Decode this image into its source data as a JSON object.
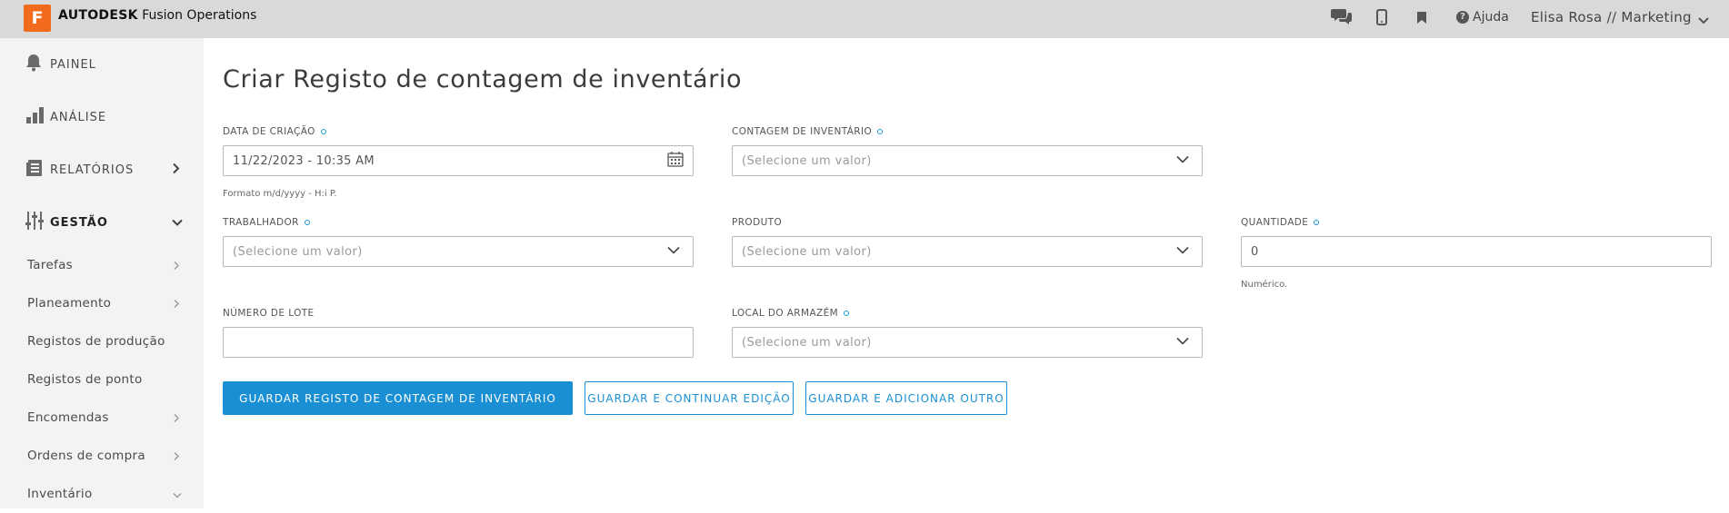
{
  "header": {
    "logo_letter": "F",
    "brand_bold": "AUTODESK",
    "brand_rest": "Fusion Operations",
    "help_label": "Ajuda",
    "user_label": "Elisa Rosa // Marketing",
    "icons": [
      "chat-icon",
      "mobile-icon",
      "bookmark-icon",
      "help-icon",
      "chevron-down-icon"
    ]
  },
  "sidebar": {
    "main_items": [
      {
        "label": "PAINEL",
        "icon": "bell-icon"
      },
      {
        "label": "ANÁLISE",
        "icon": "bar-chart-icon"
      },
      {
        "label": "RELATÓRIOS",
        "icon": "reports-icon"
      },
      {
        "label": "GESTÃO",
        "icon": "sliders-icon"
      }
    ],
    "sub_items": [
      {
        "label": "Tarefas"
      },
      {
        "label": "Planeamento"
      },
      {
        "label": "Registos de produção"
      },
      {
        "label": "Registos de ponto"
      },
      {
        "label": "Encomendas"
      },
      {
        "label": "Ordens de compra"
      },
      {
        "label": "Inventário"
      }
    ]
  },
  "form": {
    "title": "Criar Registo de contagem de inventário",
    "date_label": "DATA DE CRIAÇÃO",
    "date_value": "11/22/2023 - 10:35 AM",
    "date_hint": "Formato m/d/yyyy - H:i P.",
    "count_label": "CONTAGEM DE INVENTÁRIO",
    "count_placeholder": "(Selecione um valor)",
    "worker_label": "TRABALHADOR",
    "worker_placeholder": "(Selecione um valor)",
    "product_label": "PRODUTO",
    "product_placeholder": "(Selecione um valor)",
    "quantity_label": "QUANTIDADE",
    "quantity_value": "0",
    "quantity_hint": "Numérico.",
    "lot_label": "NÚMERO DE LOTE",
    "lot_value": "",
    "warehouse_label": "LOCAL DO ARMAZÉM",
    "warehouse_placeholder": "(Selecione um valor)"
  },
  "buttons": {
    "save_label": "GUARDAR REGISTO DE CONTAGEM DE INVENTÁRIO",
    "save_continue_label": "GUARDAR E CONTINUAR EDIÇÃO",
    "save_add_label": "GUARDAR E ADICIONAR OUTRO"
  },
  "colors": {
    "accent": "#1a8fd4",
    "logo": "#f26b1d",
    "topbar": "#d9d9d9",
    "sidebar": "#f3f3f3"
  }
}
